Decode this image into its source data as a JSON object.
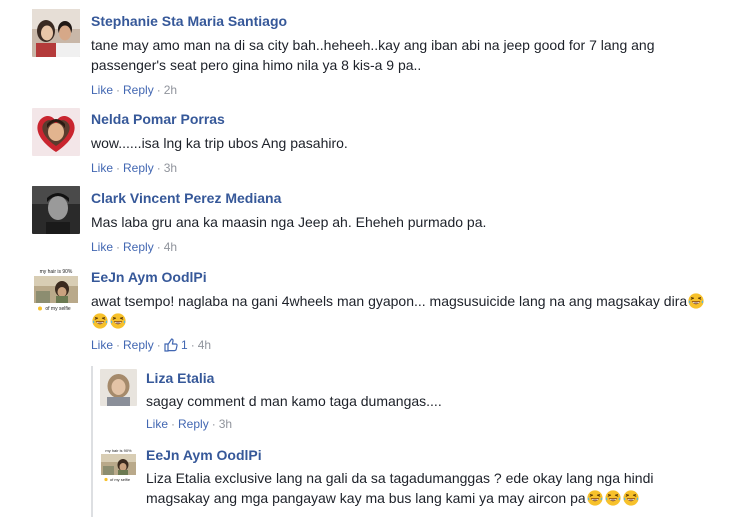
{
  "comments": [
    {
      "author": "Stephanie Sta Maria Santiago",
      "text": "tane may amo man na di sa city bah..heheeh..kay ang iban abi na jeep good for 7 lang ang passenger's seat pero gina himo nila ya 8 kis-a 9 pa..",
      "like_label": "Like",
      "reply_label": "Reply",
      "time": "2h",
      "avatar_icon": "avatar-couple-photo"
    },
    {
      "author": "Nelda Pomar Porras",
      "text": "wow......isa lng ka trip ubos Ang pasahiro.",
      "like_label": "Like",
      "reply_label": "Reply",
      "time": "3h",
      "avatar_icon": "avatar-heart-frame-photo"
    },
    {
      "author": "Clark Vincent Perez Mediana",
      "text": "Mas laba gru ana ka maasin nga Jeep ah. Eheheh purmado pa.",
      "like_label": "Like",
      "reply_label": "Reply",
      "time": "4h",
      "avatar_icon": "avatar-grayscale-photo"
    },
    {
      "author": "EeJn Aym OodlPi",
      "text": "awat tsempo! naglaba na gani 4wheels man gyapon... magsusuicide lang na ang magsakay dira",
      "like_label": "Like",
      "reply_label": "Reply",
      "like_count": "1",
      "time": "4h",
      "avatar_icon": "avatar-meme-photo",
      "avatar_caption_top": "my hair is 90%",
      "avatar_caption_bottom": "of my selfie"
    }
  ],
  "replies": [
    {
      "author": "Liza Etalia",
      "text": "sagay comment d man kamo taga dumangas....",
      "like_label": "Like",
      "reply_label": "Reply",
      "time": "3h",
      "avatar_icon": "avatar-woman-photo"
    },
    {
      "author": "EeJn Aym OodlPi",
      "text": "Liza Etalia exclusive lang na gali da sa tagadumanggas ? ede okay lang nga hindi magsakay ang mga pangayaw kay ma bus lang kami ya may aircon pa",
      "avatar_icon": "avatar-meme-photo",
      "avatar_caption_top": "my hair is 90%",
      "avatar_caption_bottom": "of my selfie"
    }
  ],
  "emoji_icon": "laughing-tears-emoji",
  "like_badge_icon": "thumbs-up-icon",
  "colors": {
    "author": "#365899",
    "link": "#4267b2",
    "meta": "#90949c",
    "text": "#1d2129",
    "like_badge": "#4267b2"
  }
}
